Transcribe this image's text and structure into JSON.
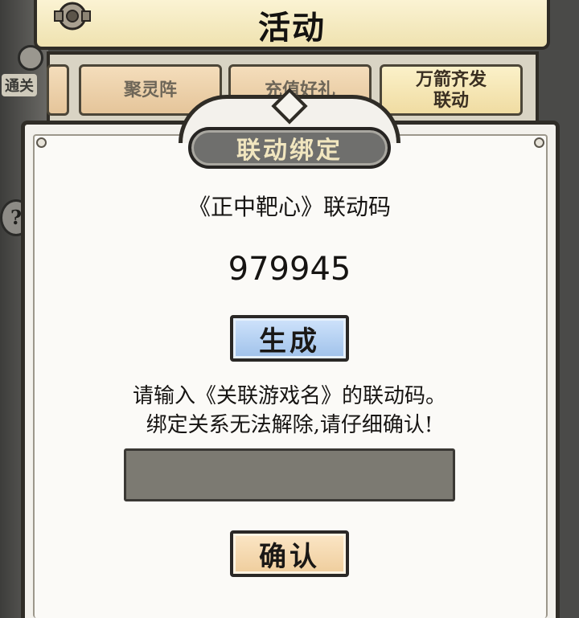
{
  "header": {
    "title": "活动"
  },
  "background": {
    "left_tag": "通关",
    "help_icon": "help-icon"
  },
  "tabs": [
    {
      "label": "聚灵阵",
      "active": false
    },
    {
      "label": "充值好礼",
      "active": false
    },
    {
      "label": "万箭齐发\n联动",
      "active": true
    }
  ],
  "dialog": {
    "title": "联动绑定",
    "code_label": "《正中靶心》联动码",
    "code_value": "979945",
    "generate_label": "生成",
    "prompt_line1": "请输入《关联游戏名》的联动码。",
    "prompt_line2": "绑定关系无法解除,请仔细确认!",
    "input_value": "",
    "confirm_label": "确认"
  },
  "colors": {
    "generate_button": "#a8c8ee",
    "confirm_button": "#f2d5a8",
    "title_plate": "#6f6f6d",
    "title_text": "#f1e6bf",
    "input_bg": "#7c7a72"
  }
}
